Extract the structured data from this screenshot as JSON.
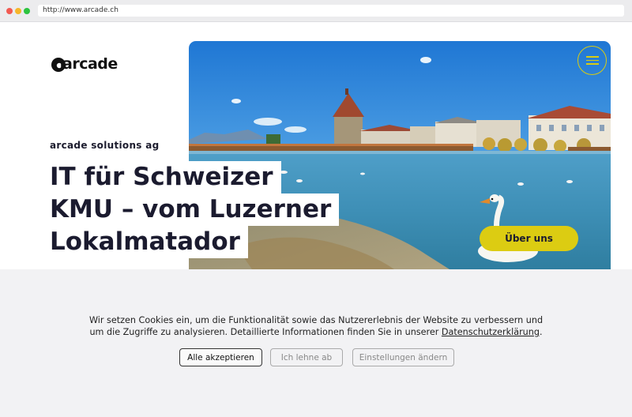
{
  "browser": {
    "url": "http://www.arcade.ch"
  },
  "header": {
    "logo_text": "arcade",
    "company_name": "arcade solutions ag"
  },
  "hero": {
    "headline_lines": [
      "IT für Schweizer",
      "KMU – vom Luzerner",
      "Lokalmatador"
    ],
    "about_button": "Über uns",
    "menu_icon": "hamburger-menu-icon"
  },
  "cookie": {
    "text_line1": "Wir setzen Cookies ein, um die Funktionalität sowie das Nutzererlebnis der Website zu verbessern und",
    "text_line2_prefix": "um die Zugriffe zu analysieren. Detaillierte Informationen finden Sie in unserer",
    "privacy_link": "Datenschutzerklärung",
    "text_suffix": ".",
    "accept_label": "Alle akzeptieren",
    "decline_label": "Ich lehne ab",
    "settings_label": "Einstellungen ändern"
  },
  "colors": {
    "accent_yellow": "#dccc12",
    "headline_navy": "#1b1b2f",
    "banner_bg": "#f2f2f4"
  }
}
